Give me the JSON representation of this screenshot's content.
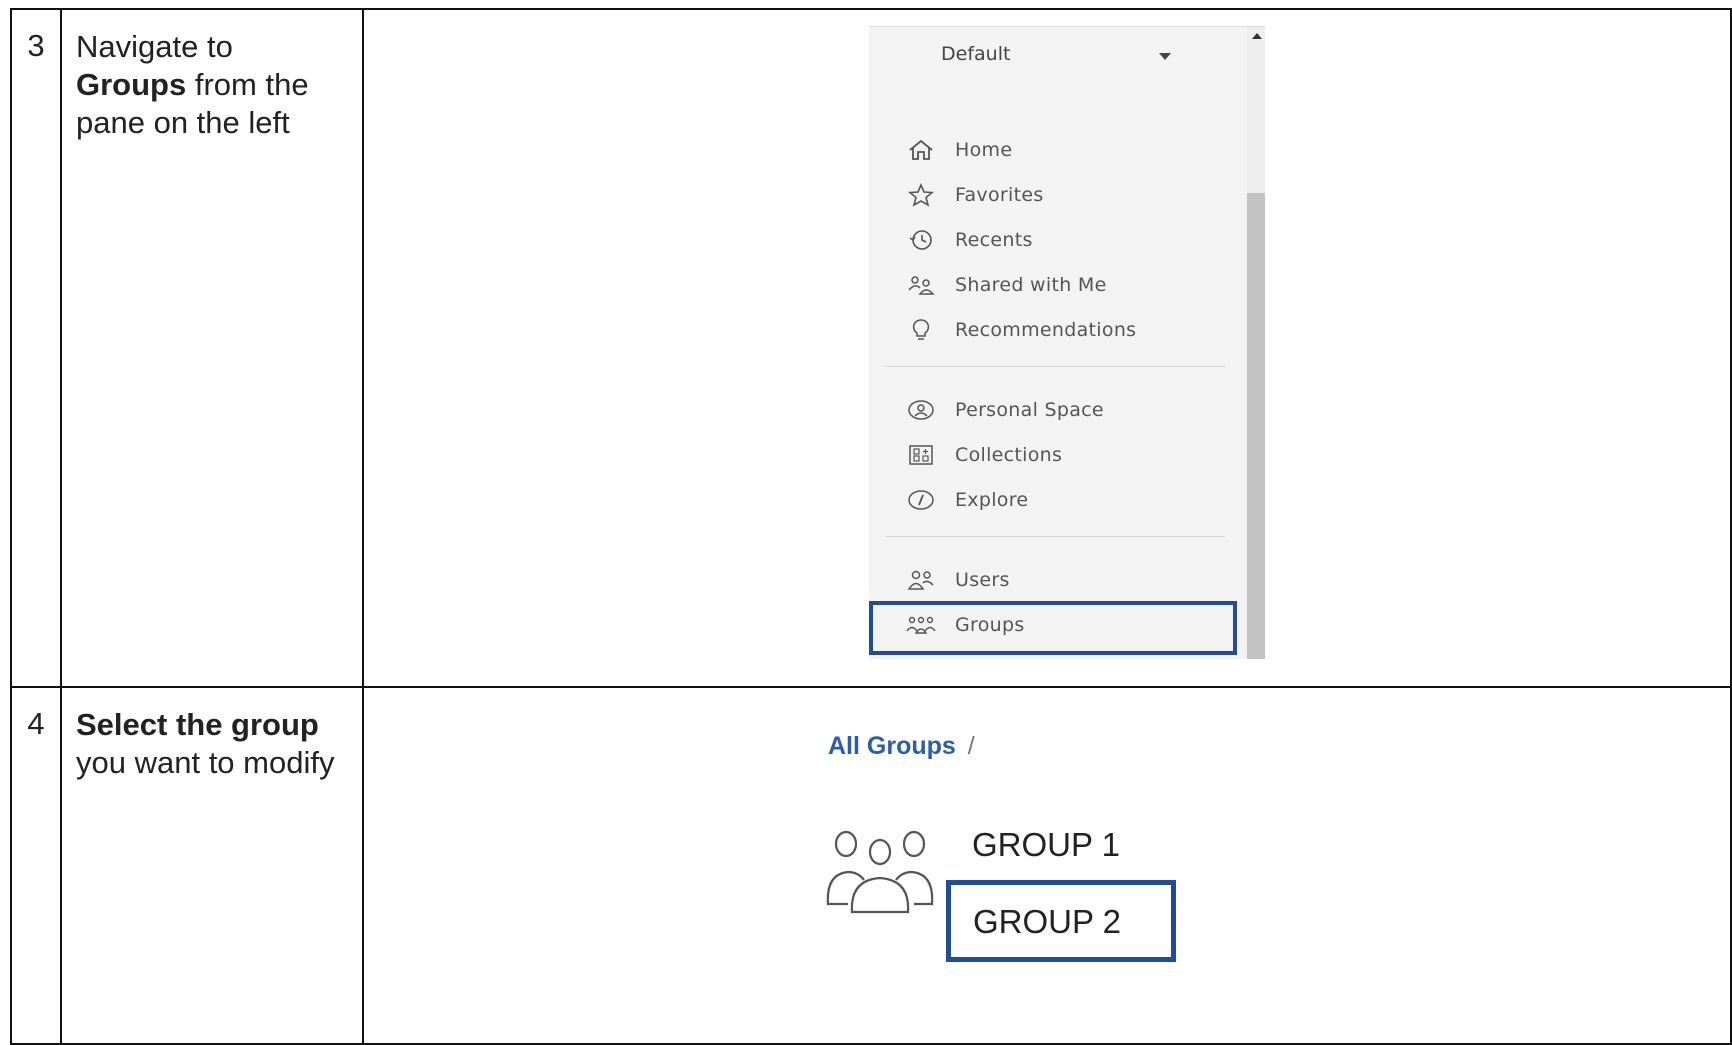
{
  "steps": [
    {
      "number": "3",
      "instruction": {
        "pre": "Navigate to ",
        "bold": "Groups",
        "post": " from the pane on the left"
      },
      "nav_pane": {
        "dropdown": "Default",
        "items": [
          {
            "label": "Home",
            "icon": "home-icon"
          },
          {
            "label": "Favorites",
            "icon": "star-icon"
          },
          {
            "label": "Recents",
            "icon": "clock-history-icon"
          },
          {
            "label": "Shared with Me",
            "icon": "shared-users-icon"
          },
          {
            "label": "Recommendations",
            "icon": "lightbulb-icon"
          },
          {
            "label": "Personal Space",
            "icon": "user-circle-icon"
          },
          {
            "label": "Collections",
            "icon": "collections-grid-icon"
          },
          {
            "label": "Explore",
            "icon": "compass-icon"
          },
          {
            "label": "Users",
            "icon": "users-icon"
          },
          {
            "label": "Groups",
            "icon": "groups-icon"
          }
        ],
        "highlighted": "Groups"
      }
    },
    {
      "number": "4",
      "instruction": {
        "bold": "Select the group",
        "post": " you want to modify"
      },
      "groups_view": {
        "breadcrumb": "All Groups",
        "breadcrumb_sep": "/",
        "groups": [
          "GROUP 1",
          "GROUP 2"
        ],
        "highlighted": "GROUP 2"
      }
    }
  ],
  "colors": {
    "highlight": "#1f4d99",
    "link": "#2a5ea8"
  }
}
